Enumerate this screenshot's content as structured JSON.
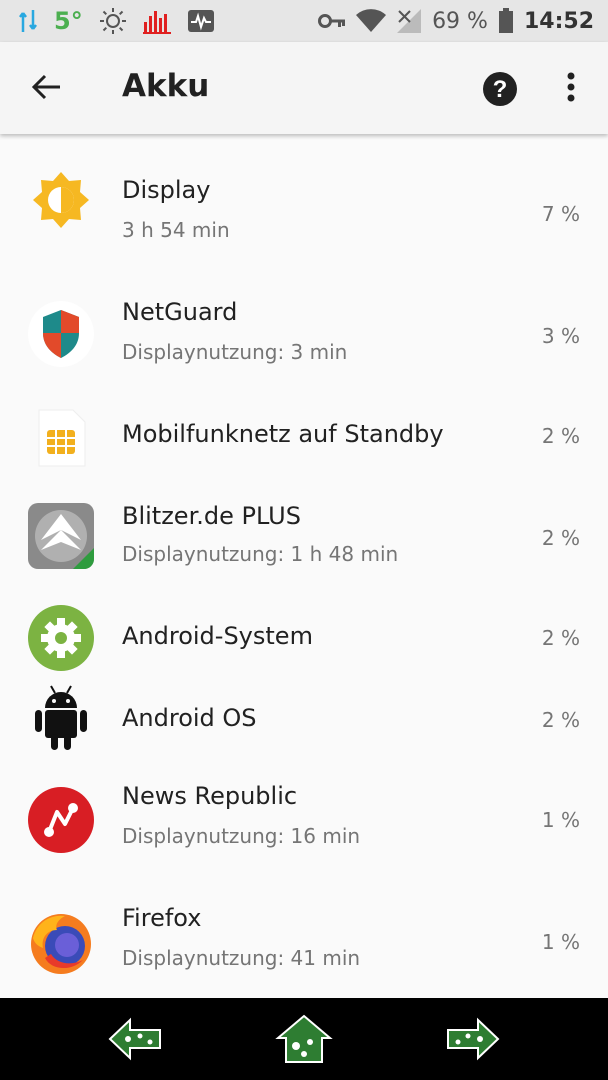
{
  "status_bar": {
    "temperature": "5°",
    "battery_percent": "69 %",
    "time": "14:52",
    "icons": [
      "data-transfer-icon",
      "temperature-icon",
      "brightness-icon",
      "signal-bars-icon",
      "activity-monitor-icon",
      "key-icon",
      "wifi-icon",
      "no-signal-icon",
      "battery-icon"
    ]
  },
  "toolbar": {
    "title": "Akku",
    "back_icon": "arrow-left-icon",
    "help_icon": "help-icon",
    "more_icon": "more-vert-icon"
  },
  "items": [
    {
      "label": "Display",
      "sub": "3 h 54 min",
      "percent": "7 %",
      "icon": "display-brightness-icon"
    },
    {
      "label": "NetGuard",
      "sub": "Displaynutzung: 3 min",
      "percent": "3 %",
      "icon": "netguard-shield-icon"
    },
    {
      "label": "Mobilfunknetz auf Standby",
      "sub": "",
      "percent": "2 %",
      "icon": "sim-card-icon"
    },
    {
      "label": "Blitzer.de PLUS",
      "sub": "Displaynutzung: 1 h 48 min",
      "percent": "2 %",
      "icon": "blitzer-app-icon"
    },
    {
      "label": "Android-System",
      "sub": "",
      "percent": "2 %",
      "icon": "android-system-gear-icon"
    },
    {
      "label": "Android OS",
      "sub": "",
      "percent": "2 %",
      "icon": "android-robot-icon"
    },
    {
      "label": "News Republic",
      "sub": "Displaynutzung: 16 min",
      "percent": "1 %",
      "icon": "news-republic-icon"
    },
    {
      "label": "Firefox",
      "sub": "Displaynutzung: 41 min",
      "percent": "1 %",
      "icon": "firefox-icon"
    }
  ],
  "nav_bar": {
    "back_icon": "nav-back-icon",
    "home_icon": "nav-home-icon",
    "forward_icon": "nav-forward-icon"
  },
  "colors": {
    "status_bar_bg": "#e6e6e6",
    "toolbar_bg": "#f5f5f5",
    "display_icon": "#f6b822",
    "navbar_green": "#2e7d32"
  }
}
